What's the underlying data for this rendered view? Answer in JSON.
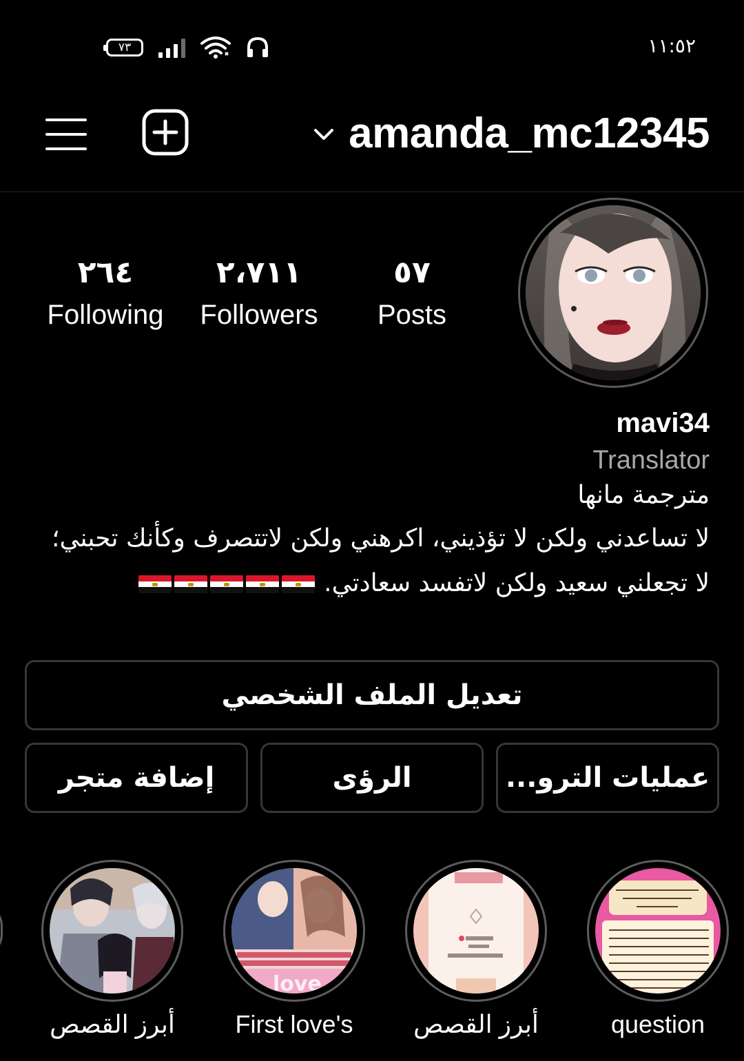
{
  "status_bar": {
    "battery": "٧٣",
    "time": "١١:٥٢",
    "icons": [
      "battery-icon",
      "signal-icon",
      "wifi-icon",
      "headphones-icon"
    ]
  },
  "header": {
    "username": "amanda_mc12345",
    "icons": [
      "menu-icon",
      "add-post-icon",
      "chevron-down-icon"
    ]
  },
  "profile": {
    "stats": {
      "posts_count": "٥٧",
      "posts_label": "Posts",
      "followers_count": "٢،٧١١",
      "followers_label": "Followers",
      "following_count": "٢٦٤",
      "following_label": "Following"
    },
    "name": "mavi34",
    "category": "Translator",
    "bio_line1": "مترجمة مانها",
    "bio_line2": "لا تساعدني ولكن لا تؤذيني، اكرهني ولكن لاتتصرف وكأنك تحبني؛",
    "bio_line3": "لا تجعلني سعيد ولكن لاتفسد سعادتي.",
    "flags": [
      "🇪🇬",
      "🇪🇬",
      "🇪🇬",
      "🇪🇬",
      "🇪🇬"
    ]
  },
  "buttons": {
    "edit_profile": "تعديل الملف الشخصي",
    "promotions": "عمليات الترو...",
    "insights": "الرؤى",
    "add_shop": "إضافة متجر"
  },
  "highlights": [
    {
      "label": "question"
    },
    {
      "label": "أبرز القصص"
    },
    {
      "label": "First love's"
    },
    {
      "label": "أبرز القصص"
    }
  ],
  "colors": {
    "background": "#000000",
    "border": "#363636",
    "secondary_text": "#a8a8a8"
  }
}
